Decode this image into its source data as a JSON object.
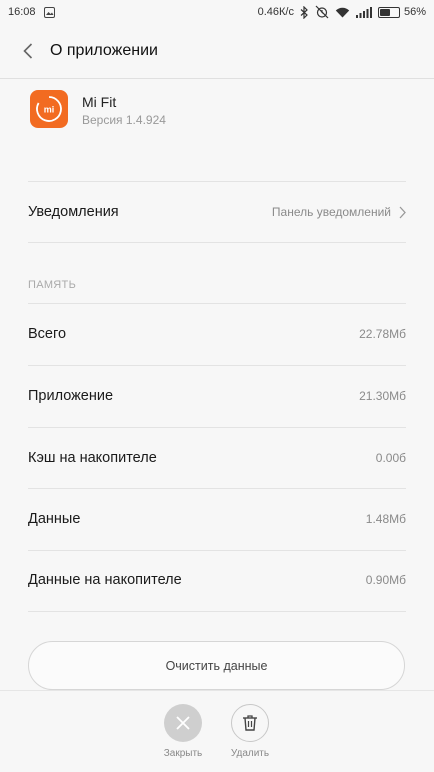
{
  "status_bar": {
    "time": "16:08",
    "network_speed": "0.46К/с",
    "battery_percent": "56%",
    "battery_level": 0.56,
    "icons": [
      "gallery-icon",
      "bluetooth-icon",
      "alarm-off-icon",
      "wifi-icon",
      "signal-icon",
      "battery-icon"
    ]
  },
  "header": {
    "title": "О приложении"
  },
  "app": {
    "name": "Mi Fit",
    "version": "Версия 1.4.924",
    "icon_text": "mi",
    "icon_color": "#f26b21"
  },
  "notifications": {
    "label": "Уведомления",
    "value": "Панель уведомлений"
  },
  "memory": {
    "section_label": "ПАМЯТЬ",
    "rows": [
      {
        "label": "Всего",
        "value": "22.78Мб"
      },
      {
        "label": "Приложение",
        "value": "21.30Мб"
      },
      {
        "label": "Кэш на накопителе",
        "value": "0.00б"
      },
      {
        "label": "Данные",
        "value": "1.48Мб"
      },
      {
        "label": "Данные на накопителе",
        "value": "0.90Мб"
      }
    ]
  },
  "clear_button": {
    "label": "Очистить данные"
  },
  "bottom_actions": {
    "close_label": "Закрыть",
    "delete_label": "Удалить"
  }
}
